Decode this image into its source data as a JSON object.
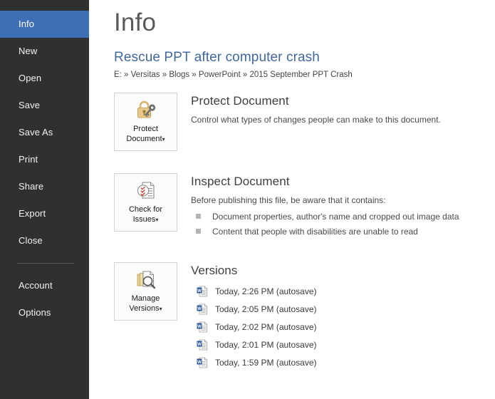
{
  "sidebar": {
    "items": [
      {
        "label": "Info",
        "active": true
      },
      {
        "label": "New",
        "active": false
      },
      {
        "label": "Open",
        "active": false
      },
      {
        "label": "Save",
        "active": false
      },
      {
        "label": "Save As",
        "active": false
      },
      {
        "label": "Print",
        "active": false
      },
      {
        "label": "Share",
        "active": false
      },
      {
        "label": "Export",
        "active": false
      },
      {
        "label": "Close",
        "active": false
      },
      {
        "label": "Account",
        "active": false
      },
      {
        "label": "Options",
        "active": false
      }
    ],
    "background_color": "#303030",
    "active_color": "#3e6fb5"
  },
  "content": {
    "page_title": "Info",
    "document_title": "Rescue PPT after computer crash",
    "document_path": "E: » Versitas » Blogs » PowerPoint » 2015 September PPT Crash",
    "title_color": "#41689c"
  },
  "protect": {
    "tile_line1": "Protect",
    "tile_line2": "Document",
    "caret": "▾",
    "icon": "padlock-key-icon",
    "heading": "Protect Document",
    "description": "Control what types of changes people can make to this document."
  },
  "inspect": {
    "tile_line1": "Check for",
    "tile_line2": "Issues",
    "caret": "▾",
    "icon": "document-checklist-icon",
    "heading": "Inspect Document",
    "description": "Before publishing this file, be aware that it contains:",
    "bullets": [
      "Document properties, author's name and cropped out image data",
      "Content that people with disabilities are unable to read"
    ]
  },
  "versions": {
    "tile_line1": "Manage",
    "tile_line2": "Versions",
    "caret": "▾",
    "icon": "documents-magnifier-icon",
    "heading": "Versions",
    "items": [
      "Today, 2:26 PM (autosave)",
      "Today, 2:05 PM (autosave)",
      "Today, 2:02 PM (autosave)",
      "Today, 2:01 PM (autosave)",
      "Today, 1:59 PM (autosave)"
    ]
  }
}
